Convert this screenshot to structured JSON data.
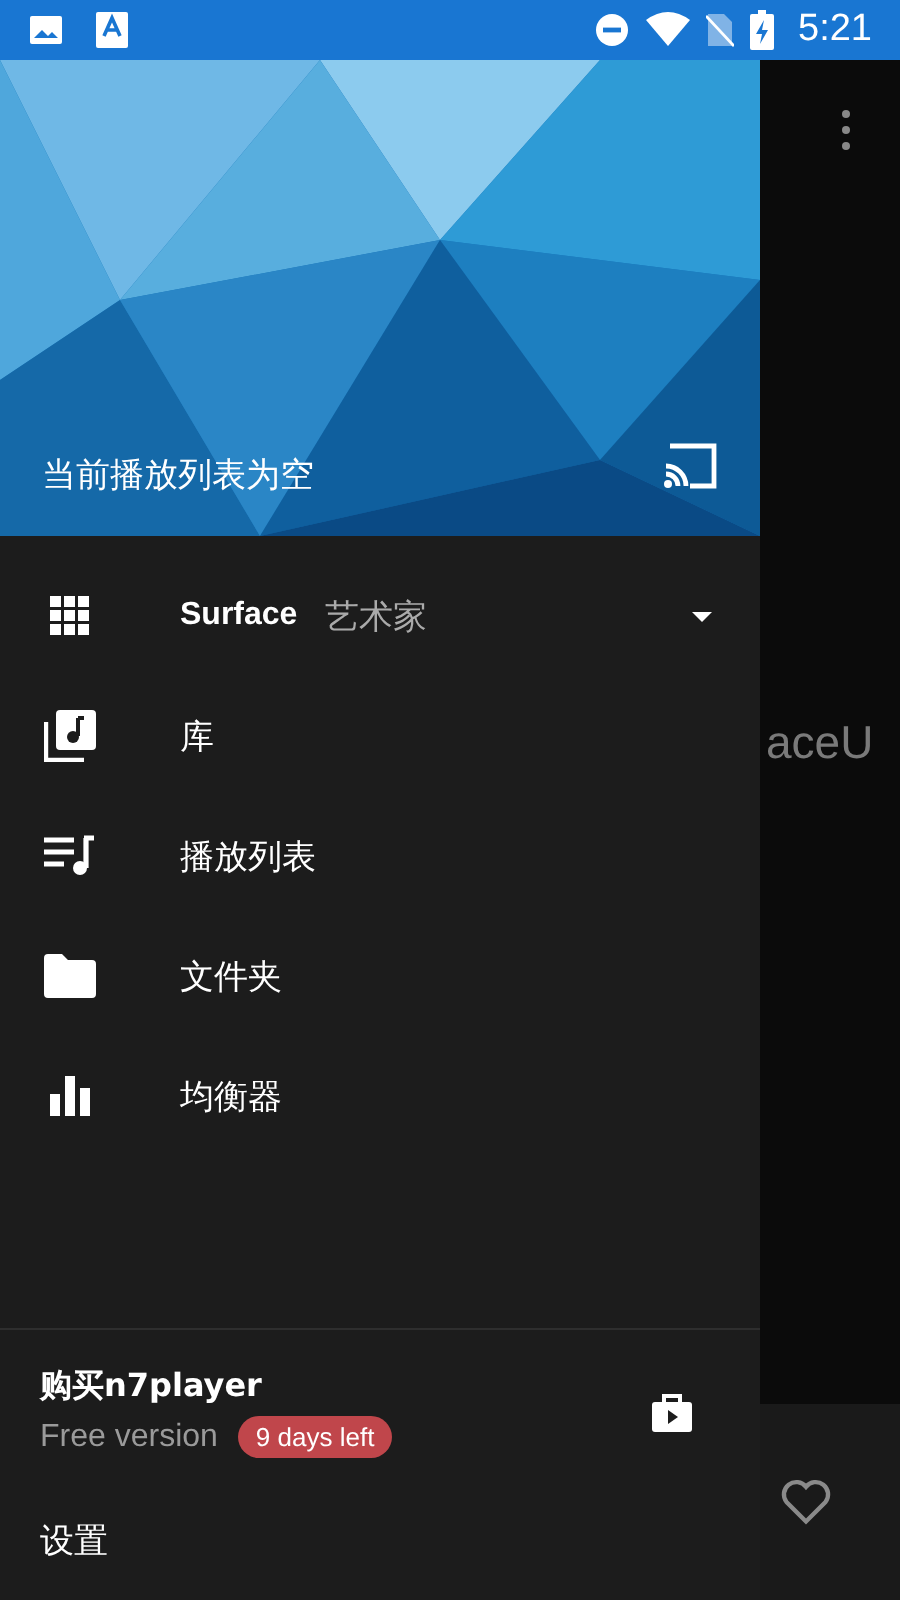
{
  "status_bar": {
    "time": "5:21"
  },
  "background_screen": {
    "text": "aceU"
  },
  "drawer": {
    "header": {
      "title": "当前播放列表为空"
    },
    "source": {
      "name": "Surface",
      "type": "艺术家"
    },
    "items": [
      {
        "label": "库"
      },
      {
        "label": "播放列表"
      },
      {
        "label": "文件夹"
      },
      {
        "label": "均衡器"
      }
    ],
    "purchase": {
      "title": "购买n7player",
      "subtitle": "Free version",
      "badge": "9 days left"
    },
    "settings": {
      "label": "设置"
    }
  }
}
